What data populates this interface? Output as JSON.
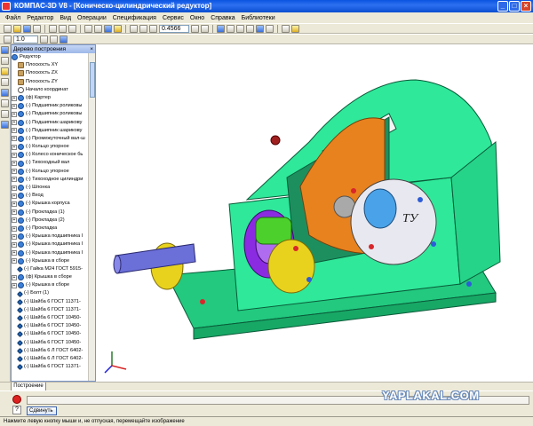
{
  "window": {
    "title": "КОМПАС-3D V8 - [Коническо-цилиндрический редуктор]"
  },
  "menu": [
    "Файл",
    "Редактор",
    "Вид",
    "Операции",
    "Спецификация",
    "Сервис",
    "Окно",
    "Справка",
    "Библиотеки"
  ],
  "toolbar": {
    "zoom_value": "0.4566",
    "scale_value": "1.0"
  },
  "tree": {
    "header": "Дерево построения",
    "root": "Редуктор",
    "items": [
      {
        "label": "Плоскость XY",
        "icon": "plane",
        "pm": ""
      },
      {
        "label": "Плоскость ZX",
        "icon": "plane",
        "pm": ""
      },
      {
        "label": "Плоскость ZY",
        "icon": "plane",
        "pm": ""
      },
      {
        "label": "Начало координат",
        "icon": "orig",
        "pm": ""
      },
      {
        "label": "(ф) Картер",
        "icon": "comp",
        "pm": "+"
      },
      {
        "label": "(-) Подшипник роликовы",
        "icon": "comp",
        "pm": "+"
      },
      {
        "label": "(-) Подшипник роликовы",
        "icon": "comp",
        "pm": "+"
      },
      {
        "label": "(-) Подшипник шарикову",
        "icon": "comp",
        "pm": "+"
      },
      {
        "label": "(-) Подшипник шарикову",
        "icon": "comp",
        "pm": "+"
      },
      {
        "label": "(-) Промежуточный вал-ш",
        "icon": "comp",
        "pm": "+"
      },
      {
        "label": "(-) Кольцо упорное",
        "icon": "comp",
        "pm": "+"
      },
      {
        "label": "(-) Колесо коническое бь",
        "icon": "comp",
        "pm": "+"
      },
      {
        "label": "(-) Тихоходный вал",
        "icon": "comp",
        "pm": "+"
      },
      {
        "label": "(-) Кольцо упорное",
        "icon": "comp",
        "pm": "+"
      },
      {
        "label": "(-) Тихоходное цилиндри",
        "icon": "comp",
        "pm": "+"
      },
      {
        "label": "(-) Шпонка",
        "icon": "comp",
        "pm": "+"
      },
      {
        "label": "(-) Вход",
        "icon": "comp",
        "pm": "+"
      },
      {
        "label": "(-) Крышка корпуса",
        "icon": "comp",
        "pm": "+"
      },
      {
        "label": "(-) Прокладка (1)",
        "icon": "comp",
        "pm": "+"
      },
      {
        "label": "(-) Прокладка (2)",
        "icon": "comp",
        "pm": "+"
      },
      {
        "label": "(-) Прокладка",
        "icon": "comp",
        "pm": "+"
      },
      {
        "label": "(-) Крышка подшипника I",
        "icon": "comp",
        "pm": "+"
      },
      {
        "label": "(-) Крышка подшипника I",
        "icon": "comp",
        "pm": "+"
      },
      {
        "label": "(-) Крышка подшипника I",
        "icon": "comp",
        "pm": "+"
      },
      {
        "label": "(-) Крышка в сборе",
        "icon": "comp",
        "pm": "+"
      },
      {
        "label": "(-) Гайка М24 ГОСТ 5915-",
        "icon": "bolt",
        "pm": ""
      },
      {
        "label": "(ф) Крышка в сборе",
        "icon": "comp",
        "pm": "+"
      },
      {
        "label": "(-) Крышка в сборе",
        "icon": "comp",
        "pm": "+"
      },
      {
        "label": "(-) Болт (1)",
        "icon": "bolt",
        "pm": ""
      },
      {
        "label": "(-) Шайба 6 ГОСТ 11371-",
        "icon": "bolt",
        "pm": ""
      },
      {
        "label": "(-) Шайба 6 ГОСТ 11371-",
        "icon": "bolt",
        "pm": ""
      },
      {
        "label": "(-) Шайба 6 ГОСТ 10450-",
        "icon": "bolt",
        "pm": ""
      },
      {
        "label": "(-) Шайба 6 ГОСТ 10450-",
        "icon": "bolt",
        "pm": ""
      },
      {
        "label": "(-) Шайба 6 ГОСТ 10450-",
        "icon": "bolt",
        "pm": ""
      },
      {
        "label": "(-) Шайба 6 ГОСТ 10450-",
        "icon": "bolt",
        "pm": ""
      },
      {
        "label": "(-) Шайба 6 Л ГОСТ 6402-",
        "icon": "bolt",
        "pm": ""
      },
      {
        "label": "(-) Шайба 6 Л ГОСТ 6402-",
        "icon": "bolt",
        "pm": ""
      },
      {
        "label": "(-) Шайба 6 ГОСТ 11371-",
        "icon": "bolt",
        "pm": ""
      }
    ]
  },
  "bottom_tab": "Построение",
  "propbar": {
    "move_button": "Сдвинуть"
  },
  "status": "Нажмите левую кнопку мыши и, не отпуская, перемещайте изображение",
  "watermark": "YAPLAKAL.COM",
  "model": {
    "cover_label": "ТУ",
    "body_color": "#2fe89a",
    "gear_color": "#e8821e",
    "pinion_color": "#8a2be2"
  }
}
